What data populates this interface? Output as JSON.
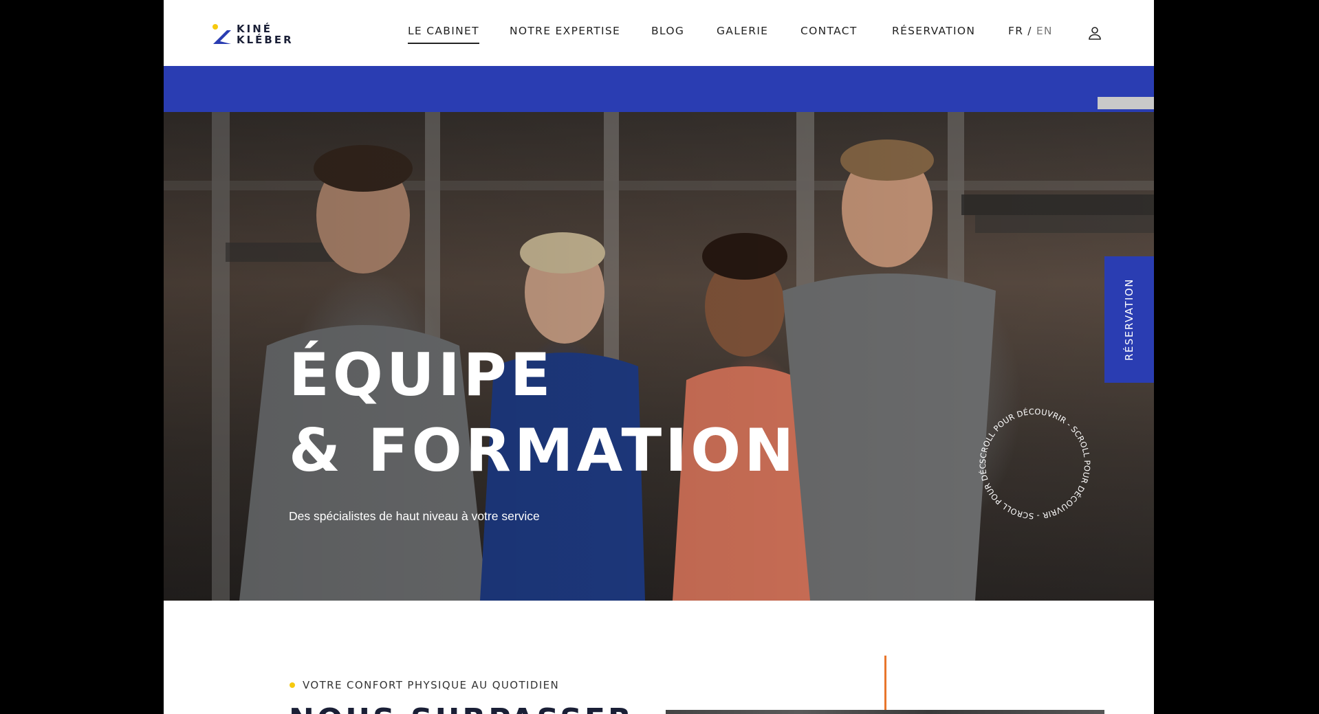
{
  "brand": {
    "line1": "KINÉ",
    "line2": "KLÉBER"
  },
  "nav": {
    "items": [
      {
        "label": "LE CABINET"
      },
      {
        "label": "NOTRE EXPERTISE"
      },
      {
        "label": "BLOG"
      },
      {
        "label": "GALERIE"
      },
      {
        "label": "CONTACT"
      },
      {
        "label": "RÉSERVATION"
      }
    ],
    "lang": {
      "fr": "FR",
      "separator": "/",
      "en": "EN"
    }
  },
  "hero": {
    "title_line1": "ÉQUIPE",
    "title_line2": "& FORMATION",
    "subtitle": "Des spécialistes de haut niveau à votre service",
    "scroll_text": "SCROLL POUR DÉCOUVRIR - SCROLL POUR DÉCOUVRIR - SCROLL POUR DÉCOUVRIR - "
  },
  "side_button": {
    "label": "RÉSERVATION"
  },
  "section": {
    "kicker": "VOTRE CONFORT PHYSIQUE AU QUOTIDIEN",
    "heading": "NOUS SURPASSER"
  },
  "colors": {
    "brand_blue": "#2a3db2",
    "accent_yellow": "#f6c90e",
    "accent_orange": "#e8762c"
  },
  "icons": {
    "logo": "kine-kleber-logo-mark",
    "user": "user-icon"
  }
}
